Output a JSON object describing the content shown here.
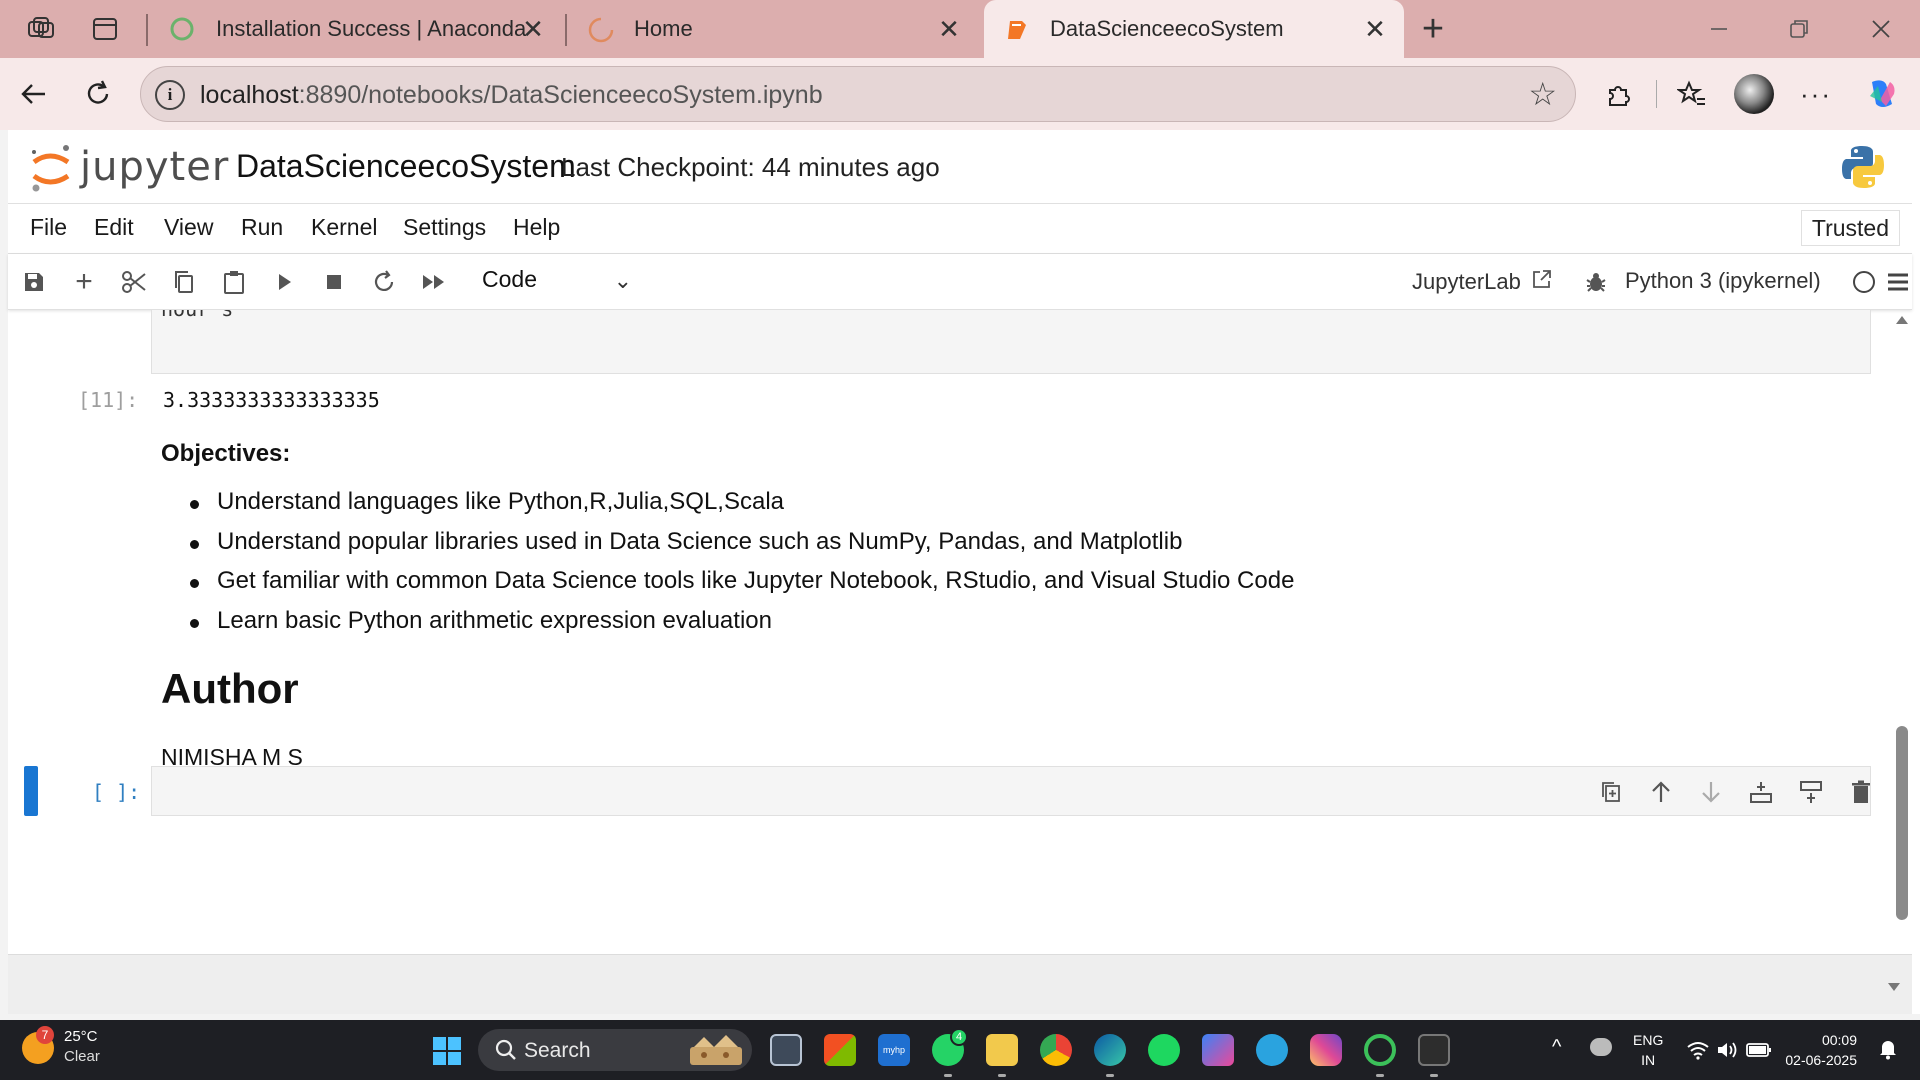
{
  "browser": {
    "tabs": [
      {
        "title": "Installation Success | Anaconda"
      },
      {
        "title": "Home"
      },
      {
        "title": "DataScienceecoSystem"
      }
    ],
    "new_tab_symbol": "+",
    "url_host": "localhost",
    "url_path": ":8890/notebooks/DataScienceecoSystem.ipynb"
  },
  "jupyter": {
    "logo_text": "jupyter",
    "notebook_title": "DataScienceecoSystem",
    "checkpoint": "Last Checkpoint: 44 minutes ago",
    "menu": [
      "File",
      "Edit",
      "View",
      "Run",
      "Kernel",
      "Settings",
      "Help"
    ],
    "trusted": "Trusted",
    "cell_type": "Code",
    "jupyterlab_link": "JupyterLab",
    "kernel": "Python 3 (ipykernel)"
  },
  "notebook": {
    "prev_cell_tail": "hour's",
    "output_prompt": "[11]:",
    "output_value": "3.3333333333333335",
    "objectives_heading": "Objectives:",
    "objectives": [
      "Understand languages like Python,R,Julia,SQL,Scala",
      "Understand popular libraries used in Data Science such as NumPy, Pandas, and Matplotlib",
      "Get familiar with common Data Science tools like Jupyter Notebook, RStudio, and Visual Studio Code",
      "Learn basic Python arithmetic expression evaluation"
    ],
    "author_heading": "Author",
    "author_name": "NIMISHA M S",
    "empty_prompt": "[ ]:"
  },
  "taskbar": {
    "weather_badge": "7",
    "temperature": "25°C",
    "condition": "Clear",
    "search_label": "Search",
    "whatsapp_badge": "4",
    "lang_line1": "ENG",
    "lang_line2": "IN",
    "time": "00:09",
    "date": "02-06-2025"
  },
  "colors": {
    "tabstrip": "#dcaeae",
    "accent_blue": "#1976d2",
    "jupyter_orange": "#f37726"
  }
}
